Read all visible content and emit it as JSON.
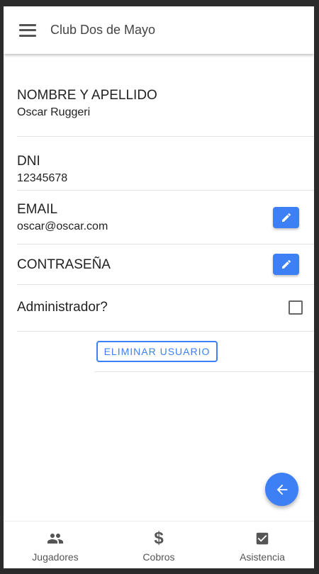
{
  "app": {
    "title": "Club Dos de Mayo"
  },
  "profile": {
    "name_label": "NOMBRE Y APELLIDO",
    "name_value": "Oscar Ruggeri",
    "dni_label": "DNI",
    "dni_value": "12345678",
    "email_label": "EMAIL",
    "email_value": "oscar@oscar.com",
    "password_label": "CONTRASEÑA",
    "admin_label": "Administrador?",
    "admin_checked": false
  },
  "actions": {
    "delete_label": "ELIMINAR USUARIO"
  },
  "nav": {
    "items": [
      {
        "label": "Jugadores",
        "icon": "people-icon"
      },
      {
        "label": "Cobros",
        "icon": "dollar-icon"
      },
      {
        "label": "Asistencia",
        "icon": "check-box-icon"
      }
    ]
  },
  "colors": {
    "accent": "#3d7ff5",
    "text": "#222222"
  }
}
